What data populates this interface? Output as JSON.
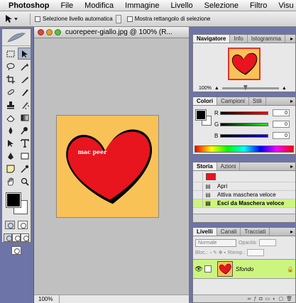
{
  "menubar": {
    "app": "Photoshop",
    "items": [
      "File",
      "Modifica",
      "Immagine",
      "Livello",
      "Selezione",
      "Filtro",
      "Visu"
    ]
  },
  "options": {
    "auto_select_label": "Selezione livello automatica",
    "show_bounding_label": "Mostra rettangolo di selezione"
  },
  "document": {
    "title": "cuorepeer-giallo.jpg @ 100% (R...",
    "zoom": "100%",
    "canvas_bg": "#f8c257",
    "heart_color": "#e8141e",
    "image_text": "mac peer"
  },
  "navigator": {
    "tabs": [
      "Navigatore",
      "Info",
      "Istogramma"
    ],
    "zoom": "100%"
  },
  "color_panel": {
    "tabs": [
      "Colori",
      "Campioni",
      "Stili"
    ],
    "channels": [
      {
        "label": "R",
        "value": "0"
      },
      {
        "label": "G",
        "value": "0"
      },
      {
        "label": "B",
        "value": "0"
      }
    ]
  },
  "history": {
    "tabs": [
      "Storia",
      "Azioni"
    ],
    "items": [
      {
        "label": "Apri",
        "selected": false
      },
      {
        "label": "Attiva maschera veloce",
        "selected": false
      },
      {
        "label": "Esci da Maschera veloce",
        "selected": true
      }
    ]
  },
  "layers": {
    "tabs": [
      "Livelli",
      "Canali",
      "Tracciati"
    ],
    "blend_mode": "Normale",
    "opacity_label": "Opacità:",
    "lock_label": "Bloc.:",
    "fill_label": "Riemp.:",
    "layer_name": "Sfondo"
  }
}
